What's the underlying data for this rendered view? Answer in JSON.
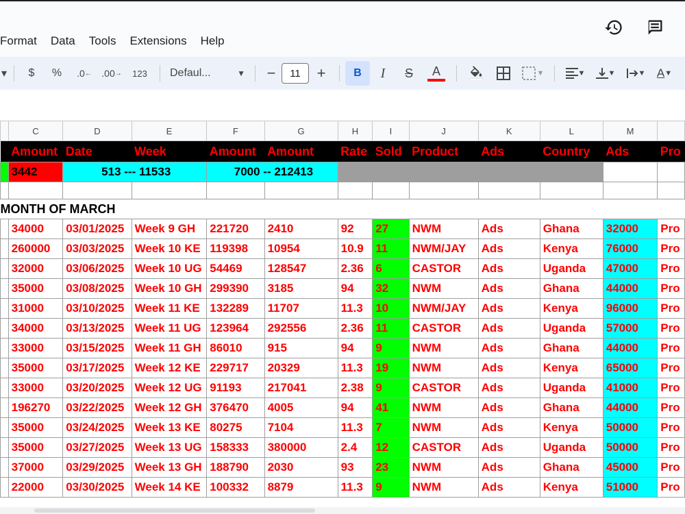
{
  "menu": [
    "Format",
    "Data",
    "Tools",
    "Extensions",
    "Help"
  ],
  "toolbar": {
    "currency": "$",
    "percent": "%",
    "dec_decrease": ".0",
    "dec_increase": ".00",
    "number_format": "123",
    "font": "Defaul...",
    "font_size": "11",
    "bold": "B",
    "italic": "I",
    "strike": "S",
    "text_color": "A",
    "text_color_swatch": "#ff0000"
  },
  "columns": [
    "C",
    "D",
    "E",
    "F",
    "G",
    "H",
    "I",
    "J",
    "K",
    "L",
    "M",
    ""
  ],
  "header": [
    "Amount",
    "Date",
    "Week",
    "Amount",
    "Amount",
    "Rate",
    "Sold",
    "Product",
    "Ads",
    "Country",
    "Ads",
    "Pro"
  ],
  "totals": {
    "first": "3442",
    "range1": "513 --- 11533",
    "range2": "7000 -- 212413"
  },
  "month_label": "MONTH OF MARCH",
  "rows": [
    [
      "34000",
      "03/01/2025",
      "Week 9 GH",
      "221720",
      "2410",
      "92",
      "27",
      "NWM",
      "Ads",
      "Ghana",
      "32000",
      "Pro"
    ],
    [
      "260000",
      "03/03/2025",
      "Week 10 KE",
      "119398",
      "10954",
      "10.9",
      "11",
      "NWM/JAY",
      "Ads",
      "Kenya",
      "76000",
      "Pro"
    ],
    [
      "32000",
      "03/06/2025",
      "Week 10 UG",
      "54469",
      "128547",
      "2.36",
      "6",
      "CASTOR",
      "Ads",
      "Uganda",
      "47000",
      "Pro"
    ],
    [
      "35000",
      "03/08/2025",
      "Week 10 GH",
      "299390",
      "3185",
      "94",
      "32",
      "NWM",
      "Ads",
      "Ghana",
      "44000",
      "Pro"
    ],
    [
      "31000",
      "03/10/2025",
      "Week 11 KE",
      "132289",
      "11707",
      "11.3",
      "10",
      "NWM/JAY",
      "Ads",
      "Kenya",
      "96000",
      "Pro"
    ],
    [
      "34000",
      "03/13/2025",
      "Week 11 UG",
      "123964",
      "292556",
      "2.36",
      "11",
      "CASTOR",
      "Ads",
      "Uganda",
      "57000",
      "Pro"
    ],
    [
      "33000",
      "03/15/2025",
      "Week 11 GH",
      "86010",
      "915",
      "94",
      "9",
      "NWM",
      "Ads",
      "Ghana",
      "44000",
      "Pro"
    ],
    [
      "35000",
      "03/17/2025",
      "Week 12 KE",
      "229717",
      "20329",
      "11.3",
      "19",
      "NWM",
      "Ads",
      "Kenya",
      "65000",
      "Pro"
    ],
    [
      "33000",
      "03/20/2025",
      "Week 12 UG",
      "91193",
      "217041",
      "2.38",
      "9",
      "CASTOR",
      "Ads",
      "Uganda",
      "41000",
      "Pro"
    ],
    [
      "196270",
      "03/22/2025",
      "Week 12 GH",
      "376470",
      "4005",
      "94",
      "41",
      "NWM",
      "Ads",
      "Ghana",
      "44000",
      "Pro"
    ],
    [
      "35000",
      "03/24/2025",
      "Week 13 KE",
      "80275",
      "7104",
      "11.3",
      "7",
      "NWM",
      "Ads",
      "Kenya",
      "50000",
      "Pro"
    ],
    [
      "35000",
      "03/27/2025",
      "Week 13 UG",
      "158333",
      "380000",
      "2.4",
      "12",
      "CASTOR",
      "Ads",
      "Uganda",
      "50000",
      "Pro"
    ],
    [
      "37000",
      "03/29/2025",
      "Week 13 GH",
      "188790",
      "2030",
      "93",
      "23",
      "NWM",
      "Ads",
      "Ghana",
      "45000",
      "Pro"
    ],
    [
      "22000",
      "03/30/2025",
      "Week 14 KE",
      "100332",
      "8879",
      "11.3",
      "9",
      "NWM",
      "Ads",
      "Kenya",
      "51000",
      "Pro"
    ]
  ]
}
